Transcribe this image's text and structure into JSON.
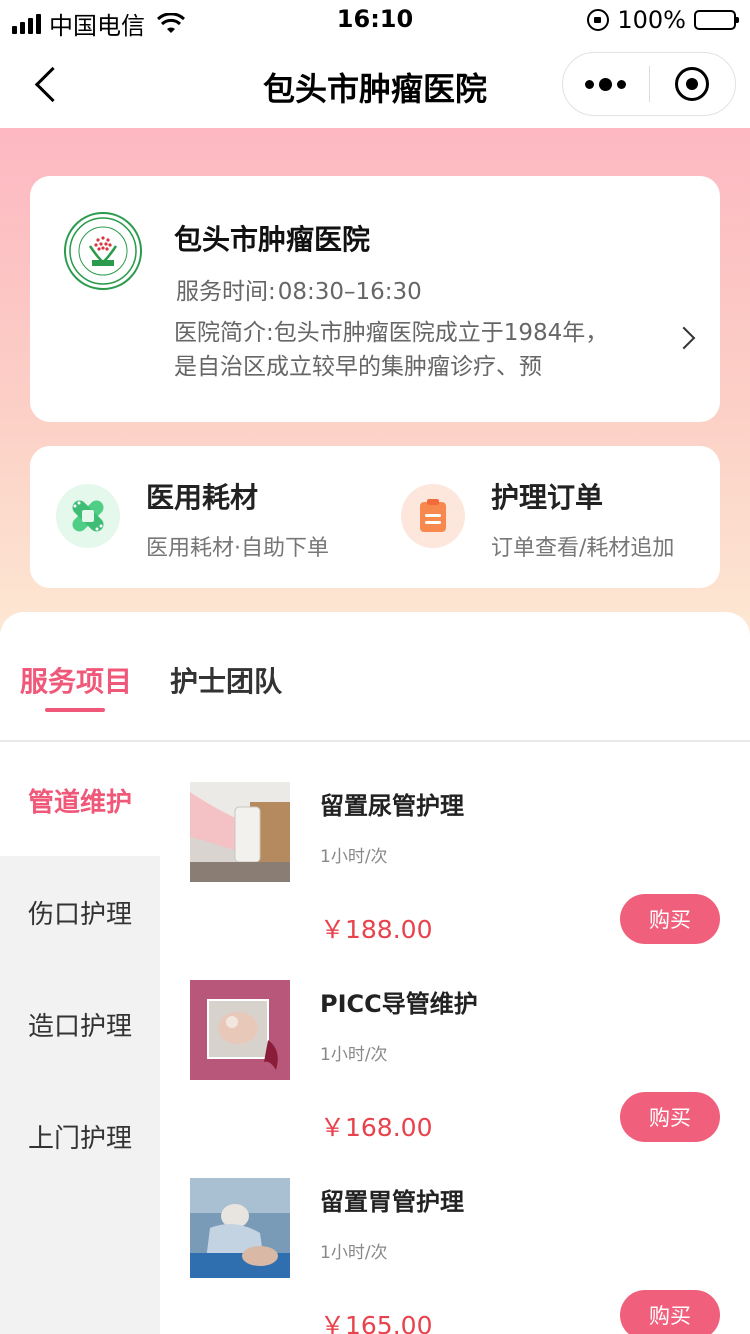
{
  "status_bar": {
    "carrier": "中国电信",
    "time": "16:10",
    "battery": "100%"
  },
  "nav": {
    "title": "包头市肿瘤医院"
  },
  "hospital": {
    "name": "包头市肿瘤医院",
    "hours_label": "服务时间:",
    "hours_value": "08:30–16:30",
    "intro": "医院简介:包头市肿瘤医院成立于1984年，是自治区成立较早的集肿瘤诊疗、预"
  },
  "quick_links": [
    {
      "title": "医用耗材",
      "subtitle": "医用耗材·自助下单",
      "icon": "bandage-icon",
      "color": "#4fce86"
    },
    {
      "title": "护理订单",
      "subtitle": "订单查看/耗材追加",
      "icon": "clipboard-icon",
      "color": "#f7894f"
    }
  ],
  "tabs": [
    {
      "label": "服务项目",
      "active": true
    },
    {
      "label": "护士团队",
      "active": false
    }
  ],
  "categories": [
    {
      "label": "管道维护",
      "active": true
    },
    {
      "label": "伤口护理",
      "active": false
    },
    {
      "label": "造口护理",
      "active": false
    },
    {
      "label": "上门护理",
      "active": false
    }
  ],
  "products": [
    {
      "name": "留置尿管护理",
      "unit": "1小时/次",
      "price": "￥188.00",
      "buy": "购买"
    },
    {
      "name": "PICC导管维护",
      "unit": "1小时/次",
      "price": "￥168.00",
      "buy": "购买"
    },
    {
      "name": "留置胃管护理",
      "unit": "1小时/次",
      "price": "￥165.00",
      "buy": "购买"
    }
  ],
  "colors": {
    "accent": "#f0587a",
    "price": "#e8434d",
    "buy_button": "#f0607c"
  }
}
